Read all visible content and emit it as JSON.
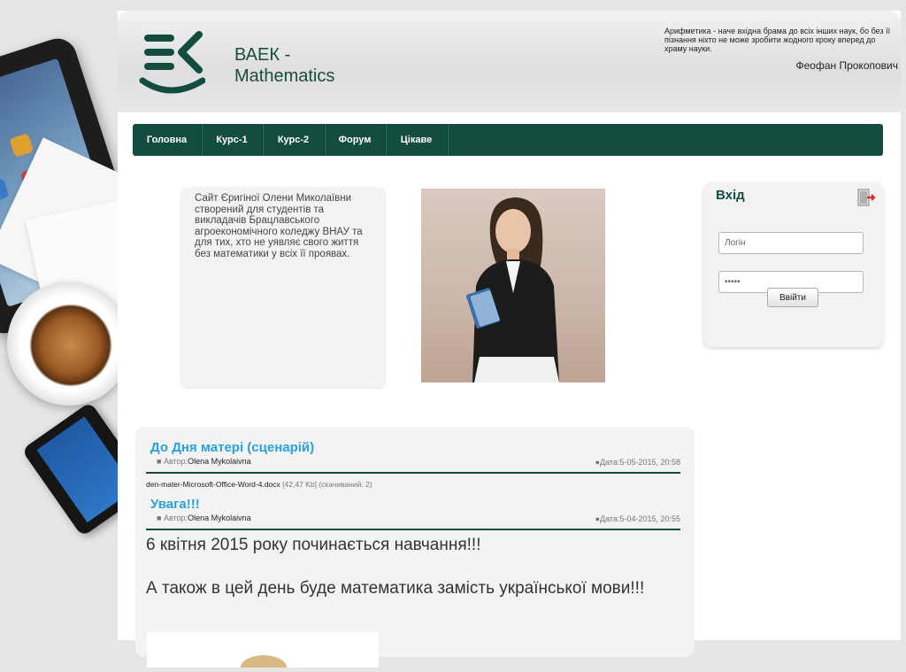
{
  "site": {
    "name": "ВАЕК - Mathematics",
    "quote": "Арифметика - наче вхідна брама до всіх інших наук, бо без її пізнання ніхто не може зробити жодного кроку вперед до храму науки.",
    "quote_author": "Феофан Прокопович"
  },
  "nav": {
    "items": [
      {
        "label": "Головна"
      },
      {
        "label": "Курс-1"
      },
      {
        "label": "Курс-2"
      },
      {
        "label": "Форум"
      },
      {
        "label": "Цікаве"
      }
    ]
  },
  "intro": {
    "text": "Сайт Єригіної Олени Миколаївни створений для студентів та викладачів Брацлавського агроекономічного коледжу ВНАУ та для тих, хто не уявляє свого життя без математики у всіх її проявах."
  },
  "login": {
    "title": "Вхід",
    "login_value": "Логін",
    "password_value": "•••••",
    "submit_label": "Ввійти"
  },
  "posts": [
    {
      "title": "До Дня матері (сценарій)",
      "author_label": "Автор:",
      "author": "Olena Mykolaivna",
      "date": "Дата:5-05-2015, 20:58",
      "attachment": {
        "file": "den-mater-Microsoft-Office-Word-4.docx",
        "info": "[42,47 Kb] (скачиваний: 2)"
      }
    },
    {
      "title": "Увага!!!",
      "author_label": "Автор:",
      "author": "Olena Mykolaivna",
      "date": "Дата:5-04-2015, 20:55",
      "body": [
        "6 квітня 2015 року починається навчання!!!",
        "А також в цей день буде математика замість української мови!!!"
      ]
    }
  ],
  "colors": {
    "nav_bg": "#124d3f",
    "post_title": "#2aa0e0",
    "brand_dark": "#124d3f"
  }
}
